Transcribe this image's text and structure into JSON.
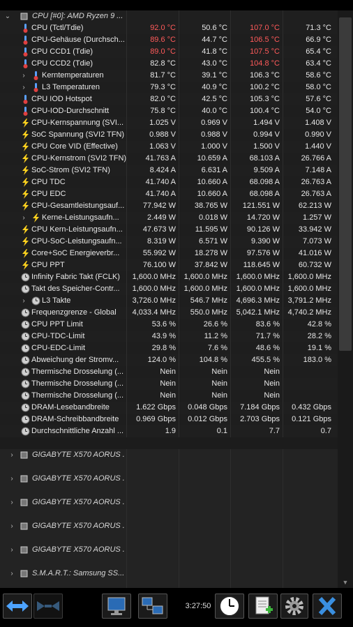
{
  "header": {
    "label": "CPU [#0]: AMD Ryzen 9 ..."
  },
  "rows": [
    {
      "name": "CPU (Tctl/Tdie)",
      "icon": "thermometer-icon",
      "indent": 0,
      "expand": false,
      "v": [
        "92.0 °C",
        "50.6 °C",
        "107.0 °C",
        "71.3 °C"
      ],
      "red": [
        true,
        false,
        true,
        false
      ]
    },
    {
      "name": "CPU-Gehäuse (Durchsch...",
      "icon": "thermometer-icon",
      "indent": 0,
      "expand": false,
      "v": [
        "89.6 °C",
        "44.7 °C",
        "106.5 °C",
        "66.9 °C"
      ],
      "red": [
        true,
        false,
        true,
        false
      ]
    },
    {
      "name": "CPU CCD1 (Tdie)",
      "icon": "thermometer-icon",
      "indent": 0,
      "expand": false,
      "v": [
        "89.0 °C",
        "41.8 °C",
        "107.5 °C",
        "65.4 °C"
      ],
      "red": [
        true,
        false,
        true,
        false
      ]
    },
    {
      "name": "CPU CCD2 (Tdie)",
      "icon": "thermometer-icon",
      "indent": 0,
      "expand": false,
      "v": [
        "82.8 °C",
        "43.0 °C",
        "104.8 °C",
        "63.4 °C"
      ],
      "red": [
        false,
        false,
        true,
        false
      ]
    },
    {
      "name": "Kerntemperaturen",
      "icon": "thermometer-icon",
      "indent": 1,
      "expand": true,
      "v": [
        "81.7 °C",
        "39.1 °C",
        "106.3 °C",
        "58.6 °C"
      ],
      "red": [
        false,
        false,
        false,
        false
      ]
    },
    {
      "name": "L3 Temperaturen",
      "icon": "thermometer-icon",
      "indent": 1,
      "expand": true,
      "v": [
        "79.3 °C",
        "40.9 °C",
        "100.2 °C",
        "58.0 °C"
      ],
      "red": [
        false,
        false,
        false,
        false
      ]
    },
    {
      "name": "CPU IOD Hotspot",
      "icon": "thermometer-icon",
      "indent": 0,
      "expand": false,
      "v": [
        "82.0 °C",
        "42.5 °C",
        "105.3 °C",
        "57.6 °C"
      ],
      "red": [
        false,
        false,
        false,
        false
      ]
    },
    {
      "name": "CPU-IOD-Durchschnitt",
      "icon": "thermometer-icon",
      "indent": 0,
      "expand": false,
      "v": [
        "75.8 °C",
        "40.0 °C",
        "100.4 °C",
        "54.0 °C"
      ],
      "red": [
        false,
        false,
        false,
        false
      ]
    },
    {
      "name": "CPU-Kernspannung (SVI...",
      "icon": "lightning-icon",
      "indent": 0,
      "expand": false,
      "v": [
        "1.025 V",
        "0.969 V",
        "1.494 V",
        "1.408 V"
      ],
      "red": [
        false,
        false,
        false,
        false
      ]
    },
    {
      "name": "SoC Spannung (SVI2 TFN)",
      "icon": "lightning-icon",
      "indent": 0,
      "expand": false,
      "v": [
        "0.988 V",
        "0.988 V",
        "0.994 V",
        "0.990 V"
      ],
      "red": [
        false,
        false,
        false,
        false
      ]
    },
    {
      "name": "CPU Core VID (Effective)",
      "icon": "lightning-icon",
      "indent": 0,
      "expand": false,
      "v": [
        "1.063 V",
        "1.000 V",
        "1.500 V",
        "1.440 V"
      ],
      "red": [
        false,
        false,
        false,
        false
      ]
    },
    {
      "name": "CPU-Kernstrom (SVI2 TFN)",
      "icon": "lightning-icon",
      "indent": 0,
      "expand": false,
      "v": [
        "41.763 A",
        "10.659 A",
        "68.103 A",
        "26.766 A"
      ],
      "red": [
        false,
        false,
        false,
        false
      ]
    },
    {
      "name": "SoC-Strom (SVI2 TFN)",
      "icon": "lightning-icon",
      "indent": 0,
      "expand": false,
      "v": [
        "8.424 A",
        "6.631 A",
        "9.509 A",
        "7.148 A"
      ],
      "red": [
        false,
        false,
        false,
        false
      ]
    },
    {
      "name": "CPU TDC",
      "icon": "lightning-icon",
      "indent": 0,
      "expand": false,
      "v": [
        "41.740 A",
        "10.660 A",
        "68.098 A",
        "26.763 A"
      ],
      "red": [
        false,
        false,
        false,
        false
      ]
    },
    {
      "name": "CPU EDC",
      "icon": "lightning-icon",
      "indent": 0,
      "expand": false,
      "v": [
        "41.740 A",
        "10.660 A",
        "68.098 A",
        "26.763 A"
      ],
      "red": [
        false,
        false,
        false,
        false
      ]
    },
    {
      "name": "CPU-Gesamtleistungsauf...",
      "icon": "lightning-icon",
      "indent": 0,
      "expand": false,
      "v": [
        "77.942 W",
        "38.765 W",
        "121.551 W",
        "62.213 W"
      ],
      "red": [
        false,
        false,
        false,
        false
      ]
    },
    {
      "name": "Kerne-Leistungsaufn...",
      "icon": "lightning-icon",
      "indent": 1,
      "expand": true,
      "v": [
        "2.449 W",
        "0.018 W",
        "14.720 W",
        "1.257 W"
      ],
      "red": [
        false,
        false,
        false,
        false
      ]
    },
    {
      "name": "CPU Kern-Leistungsaufn...",
      "icon": "lightning-icon",
      "indent": 0,
      "expand": false,
      "v": [
        "47.673 W",
        "11.595 W",
        "90.126 W",
        "33.942 W"
      ],
      "red": [
        false,
        false,
        false,
        false
      ]
    },
    {
      "name": "CPU-SoC-Leistungsaufn...",
      "icon": "lightning-icon",
      "indent": 0,
      "expand": false,
      "v": [
        "8.319 W",
        "6.571 W",
        "9.390 W",
        "7.073 W"
      ],
      "red": [
        false,
        false,
        false,
        false
      ]
    },
    {
      "name": "Core+SoC Energieverbr...",
      "icon": "lightning-icon",
      "indent": 0,
      "expand": false,
      "v": [
        "55.992 W",
        "18.278 W",
        "97.576 W",
        "41.016 W"
      ],
      "red": [
        false,
        false,
        false,
        false
      ]
    },
    {
      "name": "CPU PPT",
      "icon": "lightning-icon",
      "indent": 0,
      "expand": false,
      "v": [
        "76.100 W",
        "37.842 W",
        "118.645 W",
        "60.732 W"
      ],
      "red": [
        false,
        false,
        false,
        false
      ]
    },
    {
      "name": "Infinity Fabric Takt (FCLK)",
      "icon": "clock-icon",
      "indent": 0,
      "expand": false,
      "v": [
        "1,600.0 MHz",
        "1,600.0 MHz",
        "1,600.0 MHz",
        "1,600.0 MHz"
      ],
      "red": [
        false,
        false,
        false,
        false
      ]
    },
    {
      "name": "Takt des Speicher-Contr...",
      "icon": "clock-icon",
      "indent": 0,
      "expand": false,
      "v": [
        "1,600.0 MHz",
        "1,600.0 MHz",
        "1,600.0 MHz",
        "1,600.0 MHz"
      ],
      "red": [
        false,
        false,
        false,
        false
      ]
    },
    {
      "name": "L3 Takte",
      "icon": "clock-icon",
      "indent": 1,
      "expand": true,
      "v": [
        "3,726.0 MHz",
        "546.7 MHz",
        "4,696.3 MHz",
        "3,791.2 MHz"
      ],
      "red": [
        false,
        false,
        false,
        false
      ]
    },
    {
      "name": "Frequenzgrenze - Global",
      "icon": "clock-icon",
      "indent": 0,
      "expand": false,
      "v": [
        "4,033.4 MHz",
        "550.0 MHz",
        "5,042.1 MHz",
        "4,740.2 MHz"
      ],
      "red": [
        false,
        false,
        false,
        false
      ]
    },
    {
      "name": "CPU PPT Limit",
      "icon": "clock-icon",
      "indent": 0,
      "expand": false,
      "v": [
        "53.6 %",
        "26.6 %",
        "83.6 %",
        "42.8 %"
      ],
      "red": [
        false,
        false,
        false,
        false
      ]
    },
    {
      "name": "CPU-TDC-Limit",
      "icon": "clock-icon",
      "indent": 0,
      "expand": false,
      "v": [
        "43.9 %",
        "11.2 %",
        "71.7 %",
        "28.2 %"
      ],
      "red": [
        false,
        false,
        false,
        false
      ]
    },
    {
      "name": "CPU-EDC-Limit",
      "icon": "clock-icon",
      "indent": 0,
      "expand": false,
      "v": [
        "29.8 %",
        "7.6 %",
        "48.6 %",
        "19.1 %"
      ],
      "red": [
        false,
        false,
        false,
        false
      ]
    },
    {
      "name": "Abweichung der Stromv...",
      "icon": "clock-icon",
      "indent": 0,
      "expand": false,
      "v": [
        "124.0 %",
        "104.8 %",
        "455.5 %",
        "183.0 %"
      ],
      "red": [
        false,
        false,
        false,
        false
      ]
    },
    {
      "name": "Thermische Drosselung (...",
      "icon": "clock-icon",
      "indent": 0,
      "expand": false,
      "v": [
        "Nein",
        "Nein",
        "Nein",
        ""
      ],
      "red": [
        false,
        false,
        false,
        false
      ]
    },
    {
      "name": "Thermische Drosselung (...",
      "icon": "clock-icon",
      "indent": 0,
      "expand": false,
      "v": [
        "Nein",
        "Nein",
        "Nein",
        ""
      ],
      "red": [
        false,
        false,
        false,
        false
      ]
    },
    {
      "name": "Thermische Drosselung (...",
      "icon": "clock-icon",
      "indent": 0,
      "expand": false,
      "v": [
        "Nein",
        "Nein",
        "Nein",
        ""
      ],
      "red": [
        false,
        false,
        false,
        false
      ]
    },
    {
      "name": "DRAM-Lesebandbreite",
      "icon": "clock-icon",
      "indent": 0,
      "expand": false,
      "v": [
        "1.622 Gbps",
        "0.048 Gbps",
        "7.184 Gbps",
        "0.432 Gbps"
      ],
      "red": [
        false,
        false,
        false,
        false
      ]
    },
    {
      "name": "DRAM-Schreibbandbreite",
      "icon": "clock-icon",
      "indent": 0,
      "expand": false,
      "v": [
        "0.969 Gbps",
        "0.012 Gbps",
        "2.703 Gbps",
        "0.121 Gbps"
      ],
      "red": [
        false,
        false,
        false,
        false
      ]
    },
    {
      "name": "Durchschnittliche Anzahl ...",
      "icon": "clock-icon",
      "indent": 0,
      "expand": false,
      "v": [
        "1.9",
        "0.1",
        "7.7",
        "0.7"
      ],
      "red": [
        false,
        false,
        false,
        false
      ]
    }
  ],
  "groups": [
    {
      "label": "GIGABYTE X570 AORUS ..."
    },
    {
      "label": "GIGABYTE X570 AORUS ..."
    },
    {
      "label": "GIGABYTE X570 AORUS ..."
    },
    {
      "label": "GIGABYTE X570 AORUS ..."
    },
    {
      "label": "GIGABYTE X570 AORUS ..."
    },
    {
      "label": "S.M.A.R.T.: Samsung SS..."
    }
  ],
  "toolbar": {
    "time": "3:27:50",
    "buttons": [
      "nav-arrows-button",
      "collapse-button",
      "network-monitor-button",
      "remote-button",
      "clock-reset-button",
      "add-report-button",
      "settings-button",
      "close-button"
    ]
  },
  "colors": {
    "red_value": "#ff5a5a",
    "header_bg": "#0c1f36",
    "lightning": "#ffd21e",
    "thermo": "#5aa0ff"
  }
}
